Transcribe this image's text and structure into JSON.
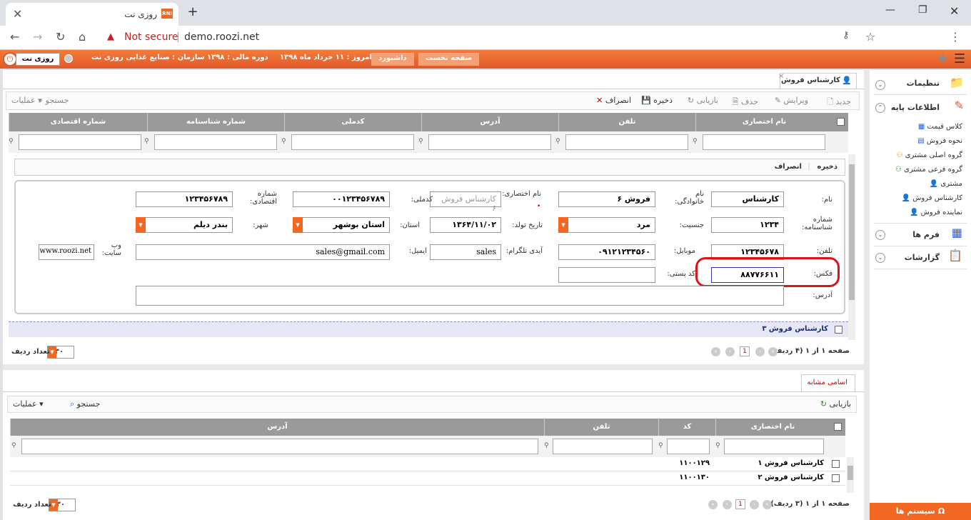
{
  "browser": {
    "tab_title": "روزی نت",
    "favicon_text": "RNI",
    "not_secure": "Not secure",
    "url": "demo.roozi.net"
  },
  "header": {
    "tab_home": "صفحه نخست",
    "tab_dashboard": "داشبورد",
    "today": "امروز :  ۱۱ خرداد ماه ۱۳۹۸",
    "fiscal": "دوره مالی :  ۱۳۹۸",
    "org": "سازمان :  صنایع غذایی روزی نت",
    "brand": "روزی نت"
  },
  "sidebar": {
    "settings": "تنظیمات",
    "basic_info": "اطلاعات پایه",
    "items": [
      "کلاس قیمت",
      "نحوه فروش",
      "گروه اصلی مشتری",
      "گروه فرعی مشتری",
      "مشتری",
      "کارشناس فروش",
      "نماینده فروش"
    ],
    "forms": "فرم ها",
    "reports": "گزارشات",
    "system": "سیستم ها"
  },
  "page": {
    "title": "کارشناس فروش",
    "toolbar": {
      "new": "جدید",
      "edit": "ویرایش",
      "delete": "حذف",
      "reload": "بازیابی",
      "save": "ذخیره",
      "cancel": "انصراف",
      "search": "جستجو",
      "ops": "عملیات"
    },
    "columns": [
      "نام اختصاری",
      "تلفن",
      "آدرس",
      "کدملی",
      "شماره شناسنامه",
      "شماره اقتصادی"
    ],
    "form_actions": {
      "save": "ذخیره",
      "cancel": "انصراف"
    },
    "labels": {
      "first_name": "نام:",
      "last_name": "نام خانوادگی:",
      "short_name": "نام اختصاری:",
      "national_code": "کدملی:",
      "economic_no": "شماره اقتصادی:",
      "id_no": "شماره شناسنامه:",
      "gender": "جنسیت:",
      "birth": "تاریخ تولد:",
      "province": "استان:",
      "city": "شهر:",
      "phone": "تلفن:",
      "mobile": "موبایل:",
      "telegram": "آیدی تلگرام:",
      "email": "ایمیل:",
      "website": "وب سایت:",
      "fax": "فکس:",
      "postal": "کد پستی:",
      "address": "آدرس:"
    },
    "values": {
      "first_name": "کارشناس",
      "last_name": "فروش ۶",
      "short_name": "کارشناس فروش ۶",
      "national_code": "۰۰۱۲۳۴۵۶۷۸۹",
      "economic_no": "۱۲۳۴۵۶۷۸۹",
      "id_no": "۱۲۳۴",
      "gender": "مرد",
      "birth": "۱۳۶۴/۱۱/۰۲",
      "province": "استان بوشهر",
      "city": "بندر دیلم",
      "phone": "۱۲۳۴۵۶۷۸",
      "mobile": "۰۹۱۲۱۲۳۴۵۶۰",
      "telegram": "sales",
      "email": "sales@gmail.com",
      "website": "www.roozi.net",
      "fax": "۸۸۷۷۶۶۱۱",
      "postal": "",
      "address": ""
    },
    "selected_row": "کارشناس فروش ۳",
    "pager": "صفحه ۱ از ۱ (۴ ردیف)",
    "page_no": "1",
    "rows_per_page": "۳۰",
    "rows_label": "تعداد ردیف"
  },
  "similar": {
    "tab": "اسامی مشابه",
    "reload": "بازیابی",
    "search": "جستجو",
    "ops": "عملیات",
    "columns": [
      "نام اختصاری",
      "کد",
      "تلفن",
      "آدرس"
    ],
    "rows": [
      {
        "name": "کارشناس فروش ۱",
        "code": "۱۱۰۰۱۲۹"
      },
      {
        "name": "کارشناس فروش ۲",
        "code": "۱۱۰۰۱۳۰"
      }
    ],
    "pager": "صفحه ۱ از ۱ (۳ ردیف)",
    "page_no": "1",
    "rows_per_page": "۳۰",
    "rows_label": "تعداد ردیف"
  }
}
